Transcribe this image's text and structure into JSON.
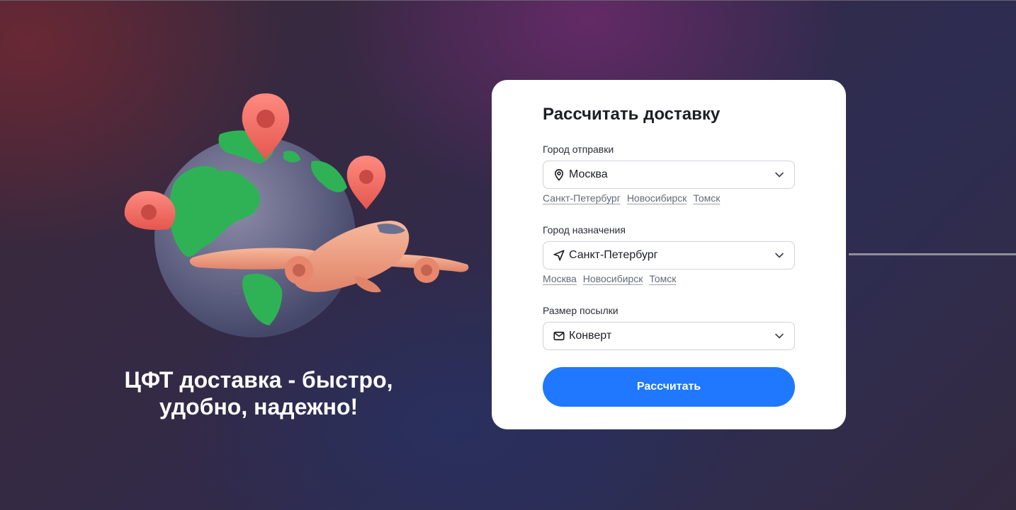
{
  "hero": {
    "tagline_line1": "ЦФТ доставка - быстро,",
    "tagline_line2": "удобно, надежно!"
  },
  "form": {
    "title": "Рассчитать доставку",
    "from": {
      "label": "Город отправки",
      "value": "Москва",
      "icon": "map-pin-icon",
      "suggestions": [
        "Санкт-Петербург",
        "Новосибирск",
        "Томск"
      ]
    },
    "to": {
      "label": "Город назначения",
      "value": "Санкт-Петербург",
      "icon": "navigation-arrow-icon",
      "suggestions": [
        "Москва",
        "Новосибирск",
        "Томск"
      ]
    },
    "size": {
      "label": "Размер посылки",
      "value": "Конверт",
      "icon": "envelope-icon"
    },
    "submit_label": "Рассчитать"
  },
  "colors": {
    "accent": "#1f78ff",
    "card_background": "#ffffff",
    "text_primary": "#1d1f24",
    "link_text": "#636a7a"
  }
}
